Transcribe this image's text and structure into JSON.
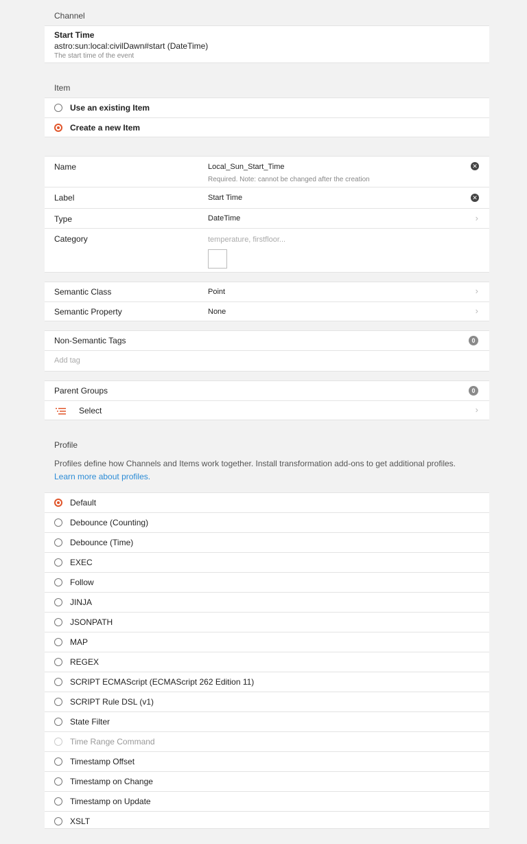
{
  "channel": {
    "header": "Channel",
    "title": "Start Time",
    "uid": "astro:sun:local:civilDawn#start (DateTime)",
    "description": "The start time of the event"
  },
  "item": {
    "header": "Item",
    "options": [
      {
        "label": "Use an existing Item",
        "checked": false
      },
      {
        "label": "Create a new Item",
        "checked": true
      }
    ]
  },
  "form": {
    "name_label": "Name",
    "name_value": "Local_Sun_Start_Time",
    "name_hint": "Required. Note: cannot be changed after the creation",
    "label_label": "Label",
    "label_value": "Start Time",
    "type_label": "Type",
    "type_value": "DateTime",
    "category_label": "Category",
    "category_placeholder": "temperature, firstfloor..."
  },
  "semantic": {
    "class_label": "Semantic Class",
    "class_value": "Point",
    "property_label": "Semantic Property",
    "property_value": "None"
  },
  "tags": {
    "label": "Non-Semantic Tags",
    "count": "0",
    "placeholder": "Add tag"
  },
  "groups": {
    "label": "Parent Groups",
    "count": "0",
    "select_label": "Select"
  },
  "profile": {
    "header": "Profile",
    "description": "Profiles define how Channels and Items work together. Install transformation add-ons to get additional profiles.",
    "link": "Learn more about profiles.",
    "options": [
      {
        "label": "Default",
        "checked": true
      },
      {
        "label": "Debounce (Counting)"
      },
      {
        "label": "Debounce (Time)"
      },
      {
        "label": "EXEC"
      },
      {
        "label": "Follow"
      },
      {
        "label": "JINJA"
      },
      {
        "label": "JSONPATH"
      },
      {
        "label": "MAP"
      },
      {
        "label": "REGEX"
      },
      {
        "label": "SCRIPT ECMAScript (ECMAScript 262 Edition 11)"
      },
      {
        "label": "SCRIPT Rule DSL (v1)"
      },
      {
        "label": "State Filter"
      },
      {
        "label": "Time Range Command",
        "disabled": true
      },
      {
        "label": "Timestamp Offset"
      },
      {
        "label": "Timestamp on Change"
      },
      {
        "label": "Timestamp on Update"
      },
      {
        "label": "XSLT"
      }
    ]
  },
  "colors": {
    "accent": "#e0552a",
    "link": "#2a8bd6",
    "background": "#f2f2f2"
  }
}
